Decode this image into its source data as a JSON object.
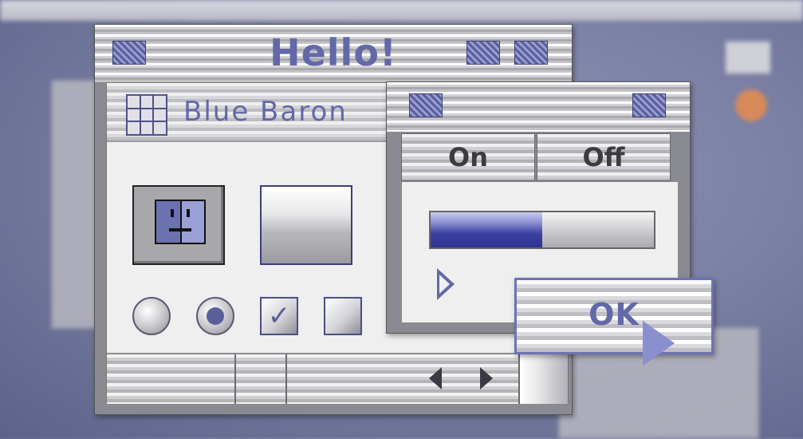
{
  "desktop": {
    "background_color": "#7b80a4",
    "accent": "#6368a8"
  },
  "main_window": {
    "title": "Hello!",
    "panel_title": "Blue Baron",
    "panel_icon": "grid-icon",
    "buttons": [
      {
        "icon": "finder-face-icon"
      },
      {
        "icon": "none"
      }
    ],
    "controls": {
      "radio_unselected": false,
      "radio_selected": true,
      "checkbox_checked": true,
      "checkbox_unchecked": false
    }
  },
  "second_window": {
    "segments": [
      "On",
      "Off"
    ],
    "progress": 0.5,
    "disclosure": "collapsed"
  },
  "dialog": {
    "ok_label": "OK"
  }
}
